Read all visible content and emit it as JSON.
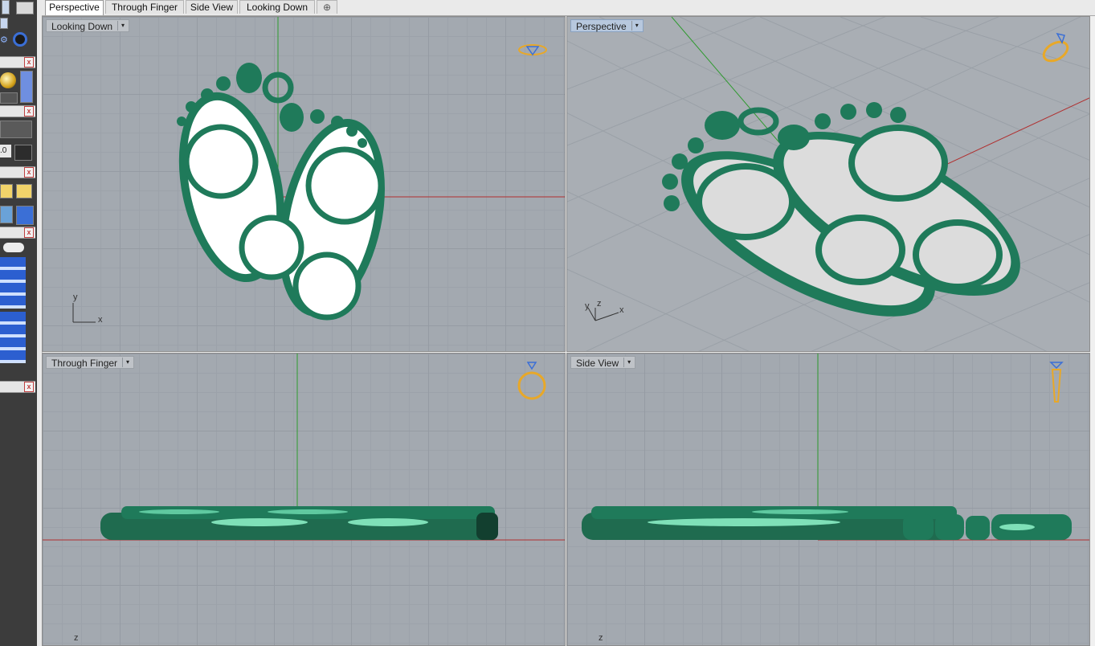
{
  "tabs": [
    {
      "label": "Perspective",
      "active": true
    },
    {
      "label": "Through Finger",
      "active": false
    },
    {
      "label": "Side View",
      "active": false
    },
    {
      "label": "Looking Down",
      "active": false
    }
  ],
  "add_tab_label": "⊕",
  "viewports": {
    "top_left": {
      "label": "Looking Down",
      "axes": {
        "y": "y",
        "x": "x"
      }
    },
    "top_right": {
      "label": "Perspective",
      "axes": {
        "y": "y",
        "z": "z",
        "x": "x"
      }
    },
    "bottom_left": {
      "label": "Through Finger",
      "axes": {
        "z": "z"
      }
    },
    "bottom_right": {
      "label": "Side View",
      "axes": {
        "z": "z"
      }
    }
  },
  "left_toolbar": {
    "value_text": ".0",
    "close_glyph": "x"
  },
  "colors": {
    "model_green": "#1f7a5a",
    "model_highlight": "#5fc9a0",
    "inlay_white": "#ffffff",
    "inlay_gray": "#dcdcdc",
    "x_axis": "#b03030",
    "y_axis": "#2e9a2e",
    "ring_icon": "#e8a828",
    "viewport_bg": "#a3a9b0"
  },
  "icons": [
    "diamond-ring-icon",
    "ring-icon",
    "close-icon",
    "dropdown-arrow-icon",
    "eye-icon",
    "layer-icon"
  ]
}
